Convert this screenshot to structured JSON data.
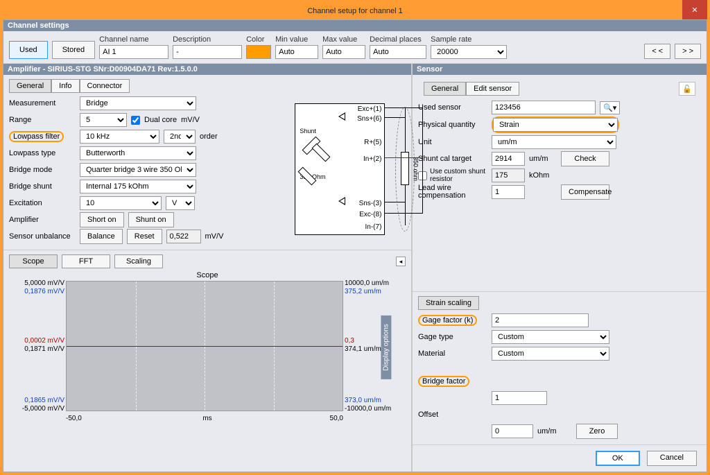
{
  "window": {
    "title": "Channel setup for channel 1"
  },
  "sections": {
    "settings": "Channel settings",
    "amplifier": "Amplifier - SIRIUS-STG  SNr:D00904DA71 Rev:1.5.0.0",
    "sensor": "Sensor"
  },
  "settings": {
    "used": "Used",
    "stored": "Stored",
    "channel_name_lbl": "Channel name",
    "channel_name": "AI 1",
    "description_lbl": "Description",
    "description": "-",
    "color_lbl": "Color",
    "min_lbl": "Min value",
    "min": "Auto",
    "max_lbl": "Max value",
    "max": "Auto",
    "dp_lbl": "Decimal places",
    "dp": "Auto",
    "sample_lbl": "Sample rate",
    "sample": "20000",
    "prev": "< <",
    "next": "> >"
  },
  "amp": {
    "tabs": {
      "general": "General",
      "info": "Info",
      "connector": "Connector"
    },
    "measurement_lbl": "Measurement",
    "measurement": "Bridge",
    "range_lbl": "Range",
    "range": "5",
    "dualcore_lbl": "Dual core",
    "range_unit": "mV/V",
    "lp_lbl": "Lowpass filter",
    "lp": "10 kHz",
    "lp_order": "2nd",
    "lp_order_suffix": "order",
    "lptype_lbl": "Lowpass type",
    "lptype": "Butterworth",
    "bmode_lbl": "Bridge mode",
    "bmode": "Quarter bridge 3 wire 350 Ohm",
    "bshunt_lbl": "Bridge shunt",
    "bshunt": "Internal 175 kOhm",
    "exc_lbl": "Excitation",
    "exc": "10",
    "exc_unit": "V",
    "ampl_lbl": "Amplifier",
    "short_on": "Short on",
    "shunt_on": "Shunt on",
    "unbal_lbl": "Sensor unbalance",
    "balance": "Balance",
    "reset": "Reset",
    "unbal_val": "0,522",
    "unbal_unit": "mV/V"
  },
  "diagram": {
    "pins": [
      "Exc+(1)",
      "Sns+(6)",
      "R+(5)",
      "In+(2)",
      "Sns-(3)",
      "Exc-(8)",
      "In-(7)"
    ],
    "shunt_lbl": "Shunt",
    "res_lbl": "350 Ohm",
    "vres_lbl": "350 ohm"
  },
  "scope": {
    "tabs": {
      "scope": "Scope",
      "fft": "FFT",
      "scaling": "Scaling"
    },
    "title": "Scope",
    "yl_top_a": "5,0000 mV/V",
    "yl_top_b": "0,1876 mV/V",
    "yl_mid_a": "0,0002 mV/V",
    "yl_mid_b": "0,1871 mV/V",
    "yl_bot_a": "0,1865 mV/V",
    "yl_bot_b": "-5,0000 mV/V",
    "yr_top_a": "10000,0 um/m",
    "yr_top_b": "375,2 um/m",
    "yr_mid_a": "0,3",
    "yr_mid_b": "374,1 um/m",
    "yr_bot_a": "373,0 um/m",
    "yr_bot_b": "-10000,0 um/m",
    "x_left": "-50,0",
    "x_mid": "ms",
    "x_right": "50,0",
    "side": "Display options"
  },
  "sensor": {
    "tabs": {
      "general": "General",
      "edit": "Edit sensor"
    },
    "used_lbl": "Used sensor",
    "used": "123456",
    "pq_lbl": "Physical quantity",
    "pq": "Strain",
    "unit_lbl": "Unit",
    "unit": "um/m",
    "sct_lbl": "Shunt cal target",
    "sct": "2914",
    "sct_unit": "um/m",
    "check": "Check",
    "custom_lbl": "Use custom shunt resistor",
    "custom_val": "175",
    "custom_unit": "kOhm",
    "lead_lbl": "Lead wire compensation",
    "lead_val": "1",
    "compensate": "Compensate"
  },
  "strain": {
    "title": "Strain scaling",
    "gage_lbl": "Gage factor (k)",
    "gage_val": "2",
    "gtype_lbl": "Gage type",
    "gtype": "Custom",
    "mat_lbl": "Material",
    "mat": "Custom",
    "bridge_lbl": "Bridge factor",
    "bridge_val": "1",
    "offset_lbl": "Offset",
    "offset_val": "0",
    "offset_unit": "um/m",
    "zero": "Zero"
  },
  "footer": {
    "ok": "OK",
    "cancel": "Cancel"
  }
}
